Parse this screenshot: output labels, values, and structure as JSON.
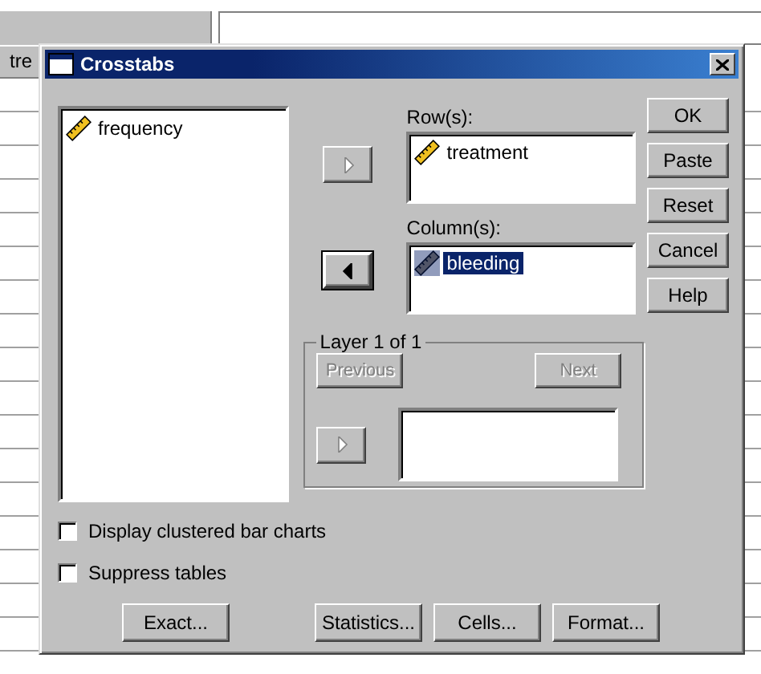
{
  "window": {
    "title": "Crosstabs"
  },
  "sheet": {
    "column_header": "tre"
  },
  "variables": [
    {
      "name": "frequency",
      "selected": false
    }
  ],
  "rows": {
    "label": "Row(s):",
    "move_button": {
      "kind": "right",
      "disabled": true,
      "focused": false
    },
    "items": [
      {
        "name": "treatment",
        "selected": false
      }
    ]
  },
  "columns": {
    "label": "Column(s):",
    "move_button": {
      "kind": "left",
      "disabled": false,
      "focused": true
    },
    "items": [
      {
        "name": "bleeding",
        "selected": true
      }
    ]
  },
  "layer": {
    "title": "Layer 1 of 1",
    "previous": {
      "label": "Previous",
      "disabled": true
    },
    "next": {
      "label": "Next",
      "disabled": true
    },
    "move_button": {
      "kind": "right",
      "disabled": true,
      "focused": false
    }
  },
  "side_buttons": [
    {
      "label": "OK"
    },
    {
      "label": "Paste"
    },
    {
      "label": "Reset"
    },
    {
      "label": "Cancel"
    },
    {
      "label": "Help"
    }
  ],
  "options": [
    {
      "label": "Display clustered bar charts",
      "checked": false
    },
    {
      "label": "Suppress tables",
      "checked": false
    }
  ],
  "bottom_buttons": [
    {
      "label": "Exact..."
    },
    {
      "label": "Statistics..."
    },
    {
      "label": "Cells..."
    },
    {
      "label": "Format..."
    }
  ]
}
